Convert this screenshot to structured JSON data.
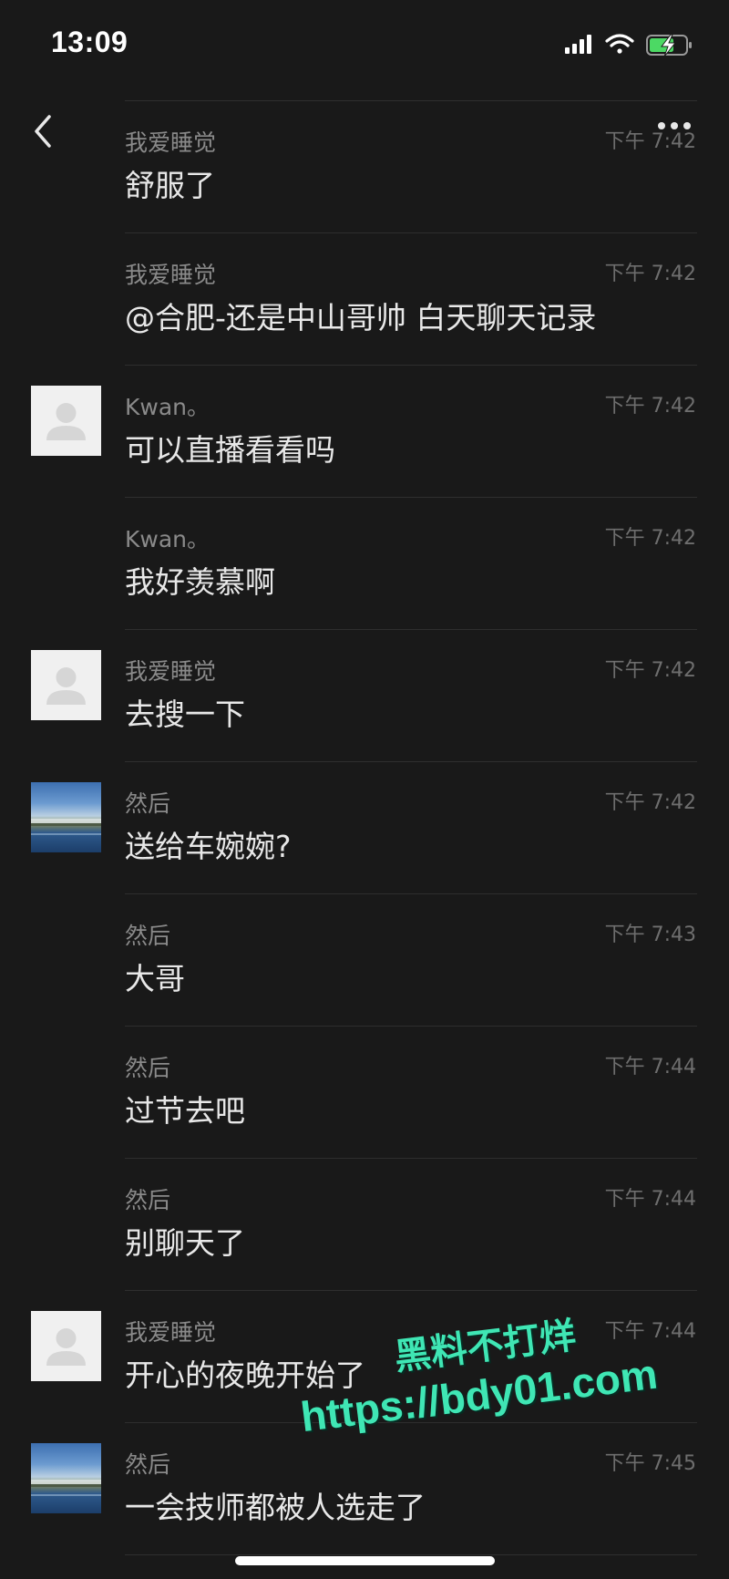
{
  "status": {
    "time": "13:09"
  },
  "messages": [
    {
      "sender": "我爱睡觉",
      "time": "下午 7:42",
      "text": "舒服了",
      "avatar": "none"
    },
    {
      "sender": "我爱睡觉",
      "time": "下午 7:42",
      "text": "@合肥-还是中山哥帅 白天聊天记录",
      "avatar": "none"
    },
    {
      "sender": "Kwan。",
      "time": "下午 7:42",
      "text": "可以直播看看吗",
      "avatar": "default"
    },
    {
      "sender": "Kwan。",
      "time": "下午 7:42",
      "text": "我好羡慕啊",
      "avatar": "none"
    },
    {
      "sender": "我爱睡觉",
      "time": "下午 7:42",
      "text": "去搜一下",
      "avatar": "default"
    },
    {
      "sender": "然后",
      "time": "下午 7:42",
      "text": "送给车婉婉?",
      "avatar": "photo"
    },
    {
      "sender": "然后",
      "time": "下午 7:43",
      "text": "大哥",
      "avatar": "none"
    },
    {
      "sender": "然后",
      "time": "下午 7:44",
      "text": "过节去吧",
      "avatar": "none"
    },
    {
      "sender": "然后",
      "time": "下午 7:44",
      "text": "别聊天了",
      "avatar": "none"
    },
    {
      "sender": "我爱睡觉",
      "time": "下午 7:44",
      "text": "开心的夜晚开始了",
      "avatar": "default"
    },
    {
      "sender": "然后",
      "time": "下午 7:45",
      "text": "一会技师都被人选走了",
      "avatar": "photo"
    }
  ],
  "watermark": {
    "line1": "黑料不打烊",
    "line2": "https://bdy01.com"
  },
  "icons": {
    "back": "chevron-left-icon",
    "more": "more-dots-icon",
    "signal": "signal-bars-icon",
    "wifi": "wifi-icon",
    "battery": "battery-charging-icon"
  },
  "colors": {
    "background": "#191919",
    "watermark": "#3fe6b4",
    "battery_charge": "#4cd964"
  }
}
